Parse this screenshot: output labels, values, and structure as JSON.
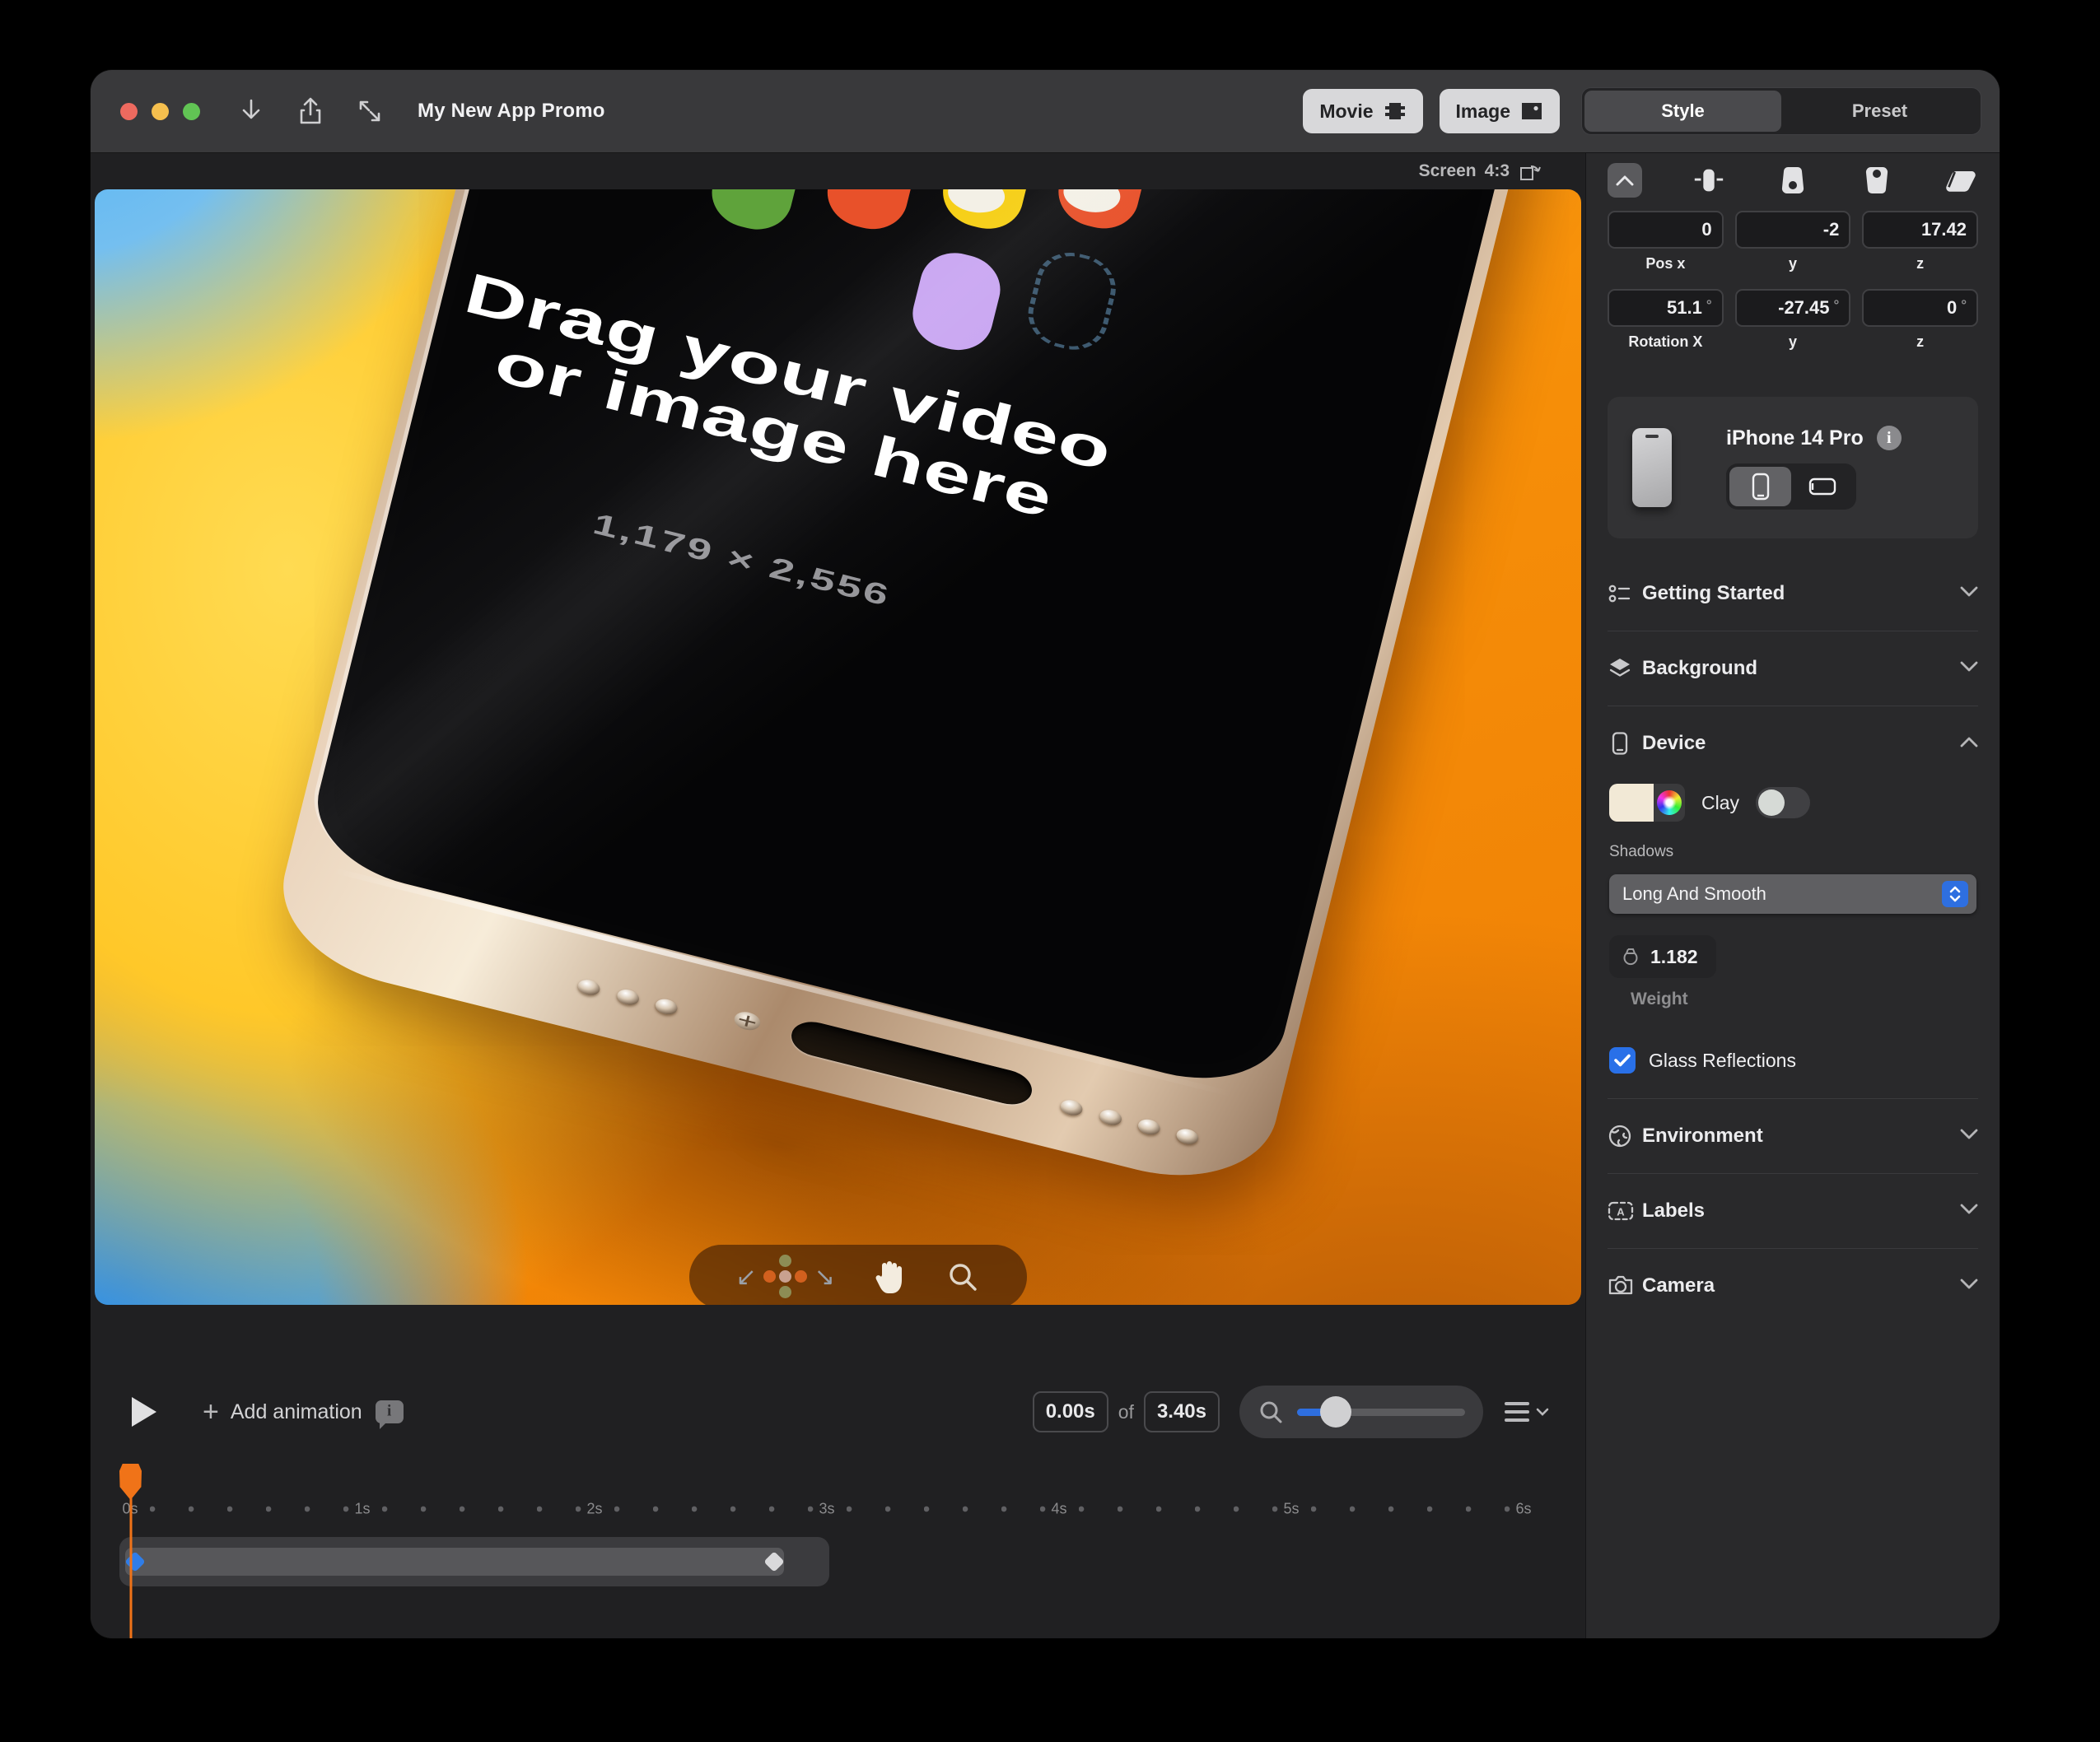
{
  "titlebar": {
    "title": "My New App Promo",
    "movie_label": "Movie",
    "image_label": "Image",
    "style_tab": "Style",
    "preset_tab": "Preset"
  },
  "canvas": {
    "screen_label": "Screen",
    "aspect_label": "4:3",
    "drop_text": "Drag your video or image here",
    "resolution": "1,179 × 2,556",
    "logo_colors": [
      "#5fa33b",
      "#f6cf16",
      "#79bdf2",
      "#c9a6f2",
      "#e8512a"
    ]
  },
  "sidebar": {
    "position": {
      "x": "0",
      "y": "-2",
      "z": "17.42",
      "x_label": "Pos x",
      "y_label": "y",
      "z_label": "z"
    },
    "rotation": {
      "x": "51.1",
      "y": "-27.45",
      "z": "0",
      "x_label": "Rotation X",
      "y_label": "y",
      "z_label": "z",
      "degree": "°"
    },
    "device_card": {
      "name": "iPhone 14 Pro"
    },
    "sections": {
      "getting_started": "Getting Started",
      "background": "Background",
      "device": "Device",
      "environment": "Environment",
      "labels": "Labels",
      "camera": "Camera"
    },
    "device_panel": {
      "clay_label": "Clay",
      "shadows_label": "Shadows",
      "shadow_type": "Long And Smooth",
      "weight_value": "1.182",
      "weight_label": "Weight",
      "glass_label": "Glass Reflections"
    }
  },
  "timeline": {
    "plus": "+",
    "add_animation": "Add animation",
    "current_time": "0.00s",
    "of_label": "of",
    "total_time": "3.40s",
    "ruler": [
      "0s",
      "1s",
      "2s",
      "3s",
      "4s",
      "5s",
      "6s"
    ]
  },
  "colors": {
    "accent_blue": "#2e6fe0",
    "playhead_orange": "#f07318",
    "swatch_cream": "#f2e9d6",
    "keyframe_blue": "#2f7de8",
    "frame_gold": "#e9d2ba"
  }
}
